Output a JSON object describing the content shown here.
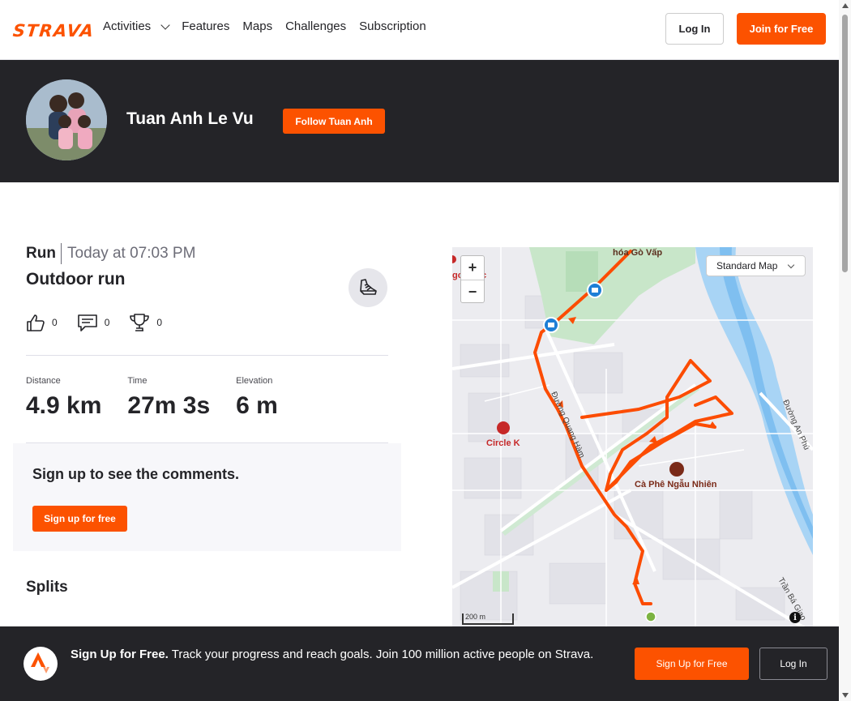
{
  "brand": {
    "name": "STRAVA",
    "accent": "#fc5200",
    "dark": "#242428"
  },
  "nav": {
    "items": [
      {
        "label": "Activities",
        "has_dropdown": true
      },
      {
        "label": "Features"
      },
      {
        "label": "Maps"
      },
      {
        "label": "Challenges"
      },
      {
        "label": "Subscription"
      }
    ],
    "login_label": "Log In",
    "join_label": "Join for Free"
  },
  "athlete": {
    "name": "Tuan Anh Le Vu",
    "follow_label": "Follow Tuan Anh"
  },
  "activity": {
    "type": "Run",
    "time": "Today at 07:03 PM",
    "name": "Outdoor run",
    "kudos": "0",
    "comments": "0",
    "achievements": "0",
    "stats": [
      {
        "label": "Distance",
        "value": "4.9 km"
      },
      {
        "label": "Time",
        "value": "27m 3s"
      },
      {
        "label": "Elevation",
        "value": "6 m"
      }
    ]
  },
  "comments": {
    "title": "Sign up to see the comments.",
    "button": "Sign up for free"
  },
  "splits": {
    "title": "Splits"
  },
  "map": {
    "style_select": "Standard Map",
    "zoom_in": "+",
    "zoom_out": "−",
    "scale": "200 m",
    "info": "i",
    "labels": {
      "top": "hóa Gò Vấp",
      "left_edge": "go",
      "left_edge2": "c",
      "circle_k": "Circle K",
      "street_quang_ham": "Đường Quang Hàm",
      "cafe": "Cà Phê Ngẫu Nhiên",
      "street_an_phu": "Đường An Phú",
      "street_tran_ba_giao": "Trần Bá Giao"
    }
  },
  "footer": {
    "bold": "Sign Up for Free.",
    "text": "Track your progress and reach goals. Join 100 million active people on Strava.",
    "signup_label": "Sign Up for Free",
    "login_label": "Log In"
  }
}
